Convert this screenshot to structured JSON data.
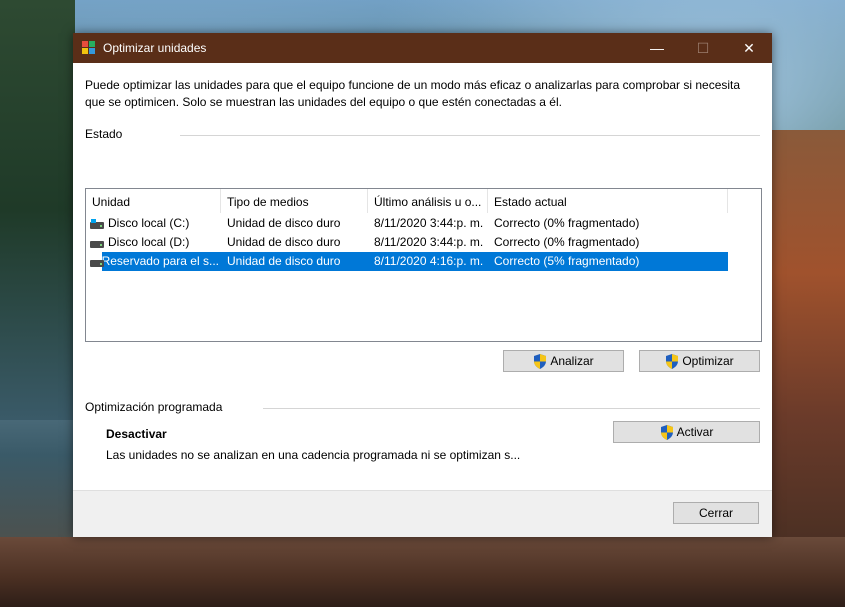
{
  "window": {
    "title": "Optimizar unidades",
    "minimize": "—",
    "maximize": "☐",
    "close": "✕"
  },
  "description": "Puede optimizar las unidades para que el equipo funcione de un modo más eficaz o analizarlas para comprobar si necesita que se optimicen. Solo se muestran las unidades del equipo o que estén conectadas a él.",
  "status_section": {
    "label": "Estado",
    "columns": [
      "Unidad",
      "Tipo de medios",
      "Último análisis u o...",
      "Estado actual"
    ],
    "rows": [
      {
        "unit": "Disco local (C:)",
        "media": "Unidad de disco duro",
        "last": "8/11/2020 3:44:p. m.",
        "state": "Correcto (0% fragmentado)",
        "icon": "windows-drive-icon",
        "selected": false
      },
      {
        "unit": "Disco local (D:)",
        "media": "Unidad de disco duro",
        "last": "8/11/2020 3:44:p. m.",
        "state": "Correcto (0% fragmentado)",
        "icon": "drive-icon",
        "selected": false
      },
      {
        "unit": "Reservado para el s...",
        "media": "Unidad de disco duro",
        "last": "8/11/2020 4:16:p. m.",
        "state": "Correcto (5% fragmentado)",
        "icon": "drive-icon",
        "selected": true
      }
    ],
    "analyze_label": "Analizar",
    "optimize_label": "Optimizar"
  },
  "scheduled_section": {
    "label": "Optimización programada",
    "status": "Desactivar",
    "description": "Las unidades no se analizan en una cadencia programada ni se optimizan s...",
    "activate_label": "Activar"
  },
  "footer": {
    "close_label": "Cerrar"
  },
  "colors": {
    "titlebar": "#5a2e18",
    "selection": "#0078d7"
  }
}
